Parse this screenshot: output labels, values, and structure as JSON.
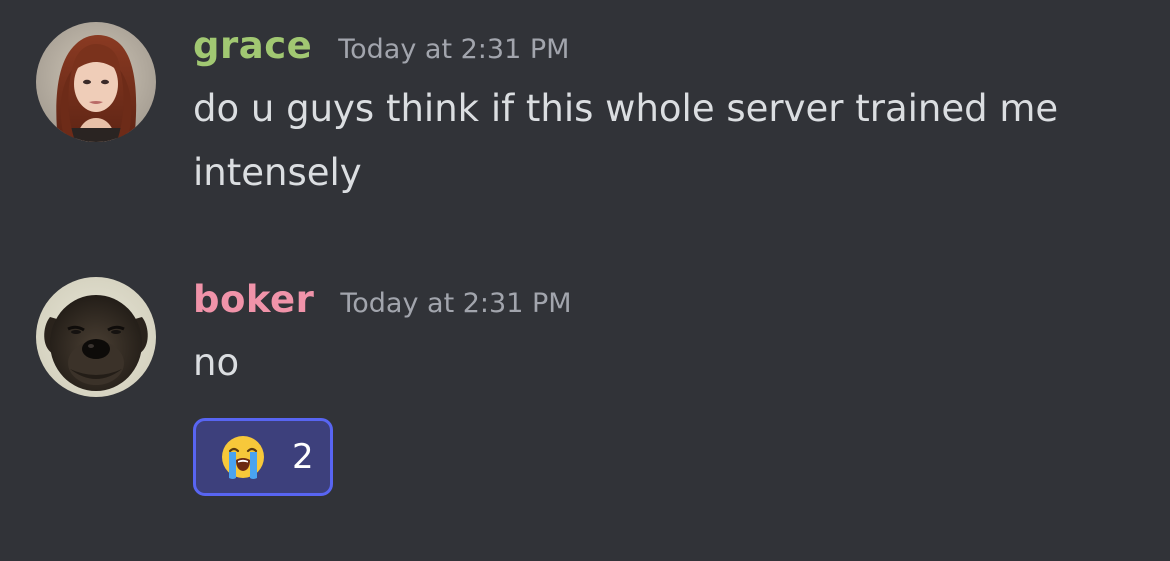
{
  "colors": {
    "background": "#313338",
    "message_text": "#dbdee1",
    "timestamp": "#a2a5ad",
    "reaction_border": "#5865f2",
    "reaction_fill": "#3d407c"
  },
  "messages": [
    {
      "author": "grace",
      "author_color": "#a1c872",
      "timestamp": "Today at 2:31 PM",
      "avatar_icon": "woman-red-hair-avatar",
      "text": "do u guys think if this whole server trained me intensely"
    },
    {
      "author": "boker",
      "author_color": "#f093a9",
      "timestamp": "Today at 2:31 PM",
      "avatar_icon": "dog-face-avatar",
      "text": "no",
      "reaction": {
        "emoji_icon": "loudly-crying-face-icon",
        "count": "2"
      }
    }
  ]
}
